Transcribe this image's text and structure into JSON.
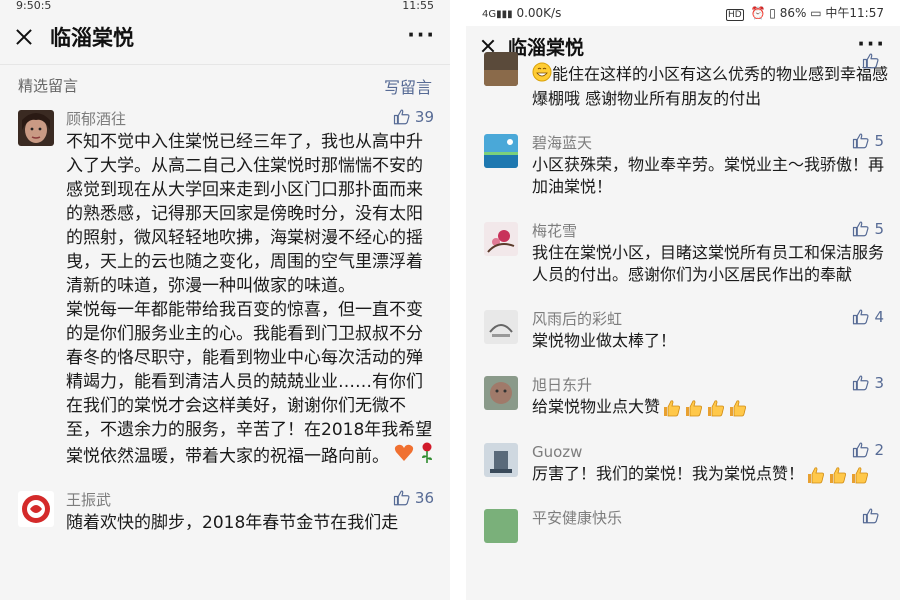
{
  "left": {
    "status": {
      "left": "9:50:5",
      "right": "11:55"
    },
    "title": "临淄棠悦",
    "section_label": "精选留言",
    "write_label": "写留言",
    "comments": [
      {
        "name": "顾郁酒往",
        "likes": "39",
        "paragraphs": [
          "不知不觉中入住棠悦已经三年了，我也从高中升入了大学。从高二自己入住棠悦时那惴惴不安的感觉到现在从大学回来走到小区门口那扑面而来的熟悉感，记得那天回家是傍晚时分，没有太阳的照射，微风轻轻地吹拂，海棠树漫不经心的摇曳，天上的云也随之变化，周围的空气里漂浮着清新的味道，弥漫一种叫做家的味道。",
          "棠悦每一年都能带给我百变的惊喜，但一直不变的是你们服务业主的心。我能看到门卫叔叔不分春冬的恪尽职守，能看到物业中心每次活动的殚精竭力，能看到清洁人员的兢兢业业……有你们在我们的棠悦才会这样美好，谢谢你们无微不至，不遗余力的服务，辛苦了！在2018年我希望棠悦依然温暖，带着大家的祝福一路向前。"
        ],
        "emojis": [
          "heart-emoji",
          "rose-emoji"
        ]
      },
      {
        "name": "王振武",
        "likes": "36",
        "paragraphs": [
          "随着欢快的脚步，2018年春节金节在我们走"
        ]
      }
    ]
  },
  "right": {
    "status": {
      "network": "0.00K/s",
      "battery": "86%",
      "time": "中午11:57"
    },
    "title": "临淄棠悦",
    "partial_top": {
      "text": "能住在这样的小区有这么优秀的物业感到幸福感爆棚哦   感谢物业所有朋友的付出",
      "emoji": "grin-emoji"
    },
    "comments": [
      {
        "name": "碧海蓝天",
        "likes": "5",
        "text": "小区获殊荣，物业奉辛劳。棠悦业主～我骄傲！再加油棠悦！",
        "thumbs": 0
      },
      {
        "name": "梅花雪",
        "likes": "5",
        "text": "我住在棠悦小区，目睹这棠悦所有员工和保洁服务人员的付出。感谢你们为小区居民作出的奉献",
        "thumbs": 0
      },
      {
        "name": "风雨后的彩虹",
        "likes": "4",
        "text": "棠悦物业做太棒了！",
        "thumbs": 0
      },
      {
        "name": "旭日东升",
        "likes": "3",
        "text": "给棠悦物业点大赞",
        "thumbs": 4
      },
      {
        "name": "Guozw",
        "likes": "2",
        "text": "厉害了！我们的棠悦！我为棠悦点赞！",
        "thumbs": 3
      },
      {
        "name": "平安健康快乐",
        "likes": "",
        "text": "",
        "thumbs": 0
      }
    ]
  },
  "colors": {
    "link": "#576b95",
    "name": "#7d7d7d",
    "bg": "#f5f5f5"
  }
}
